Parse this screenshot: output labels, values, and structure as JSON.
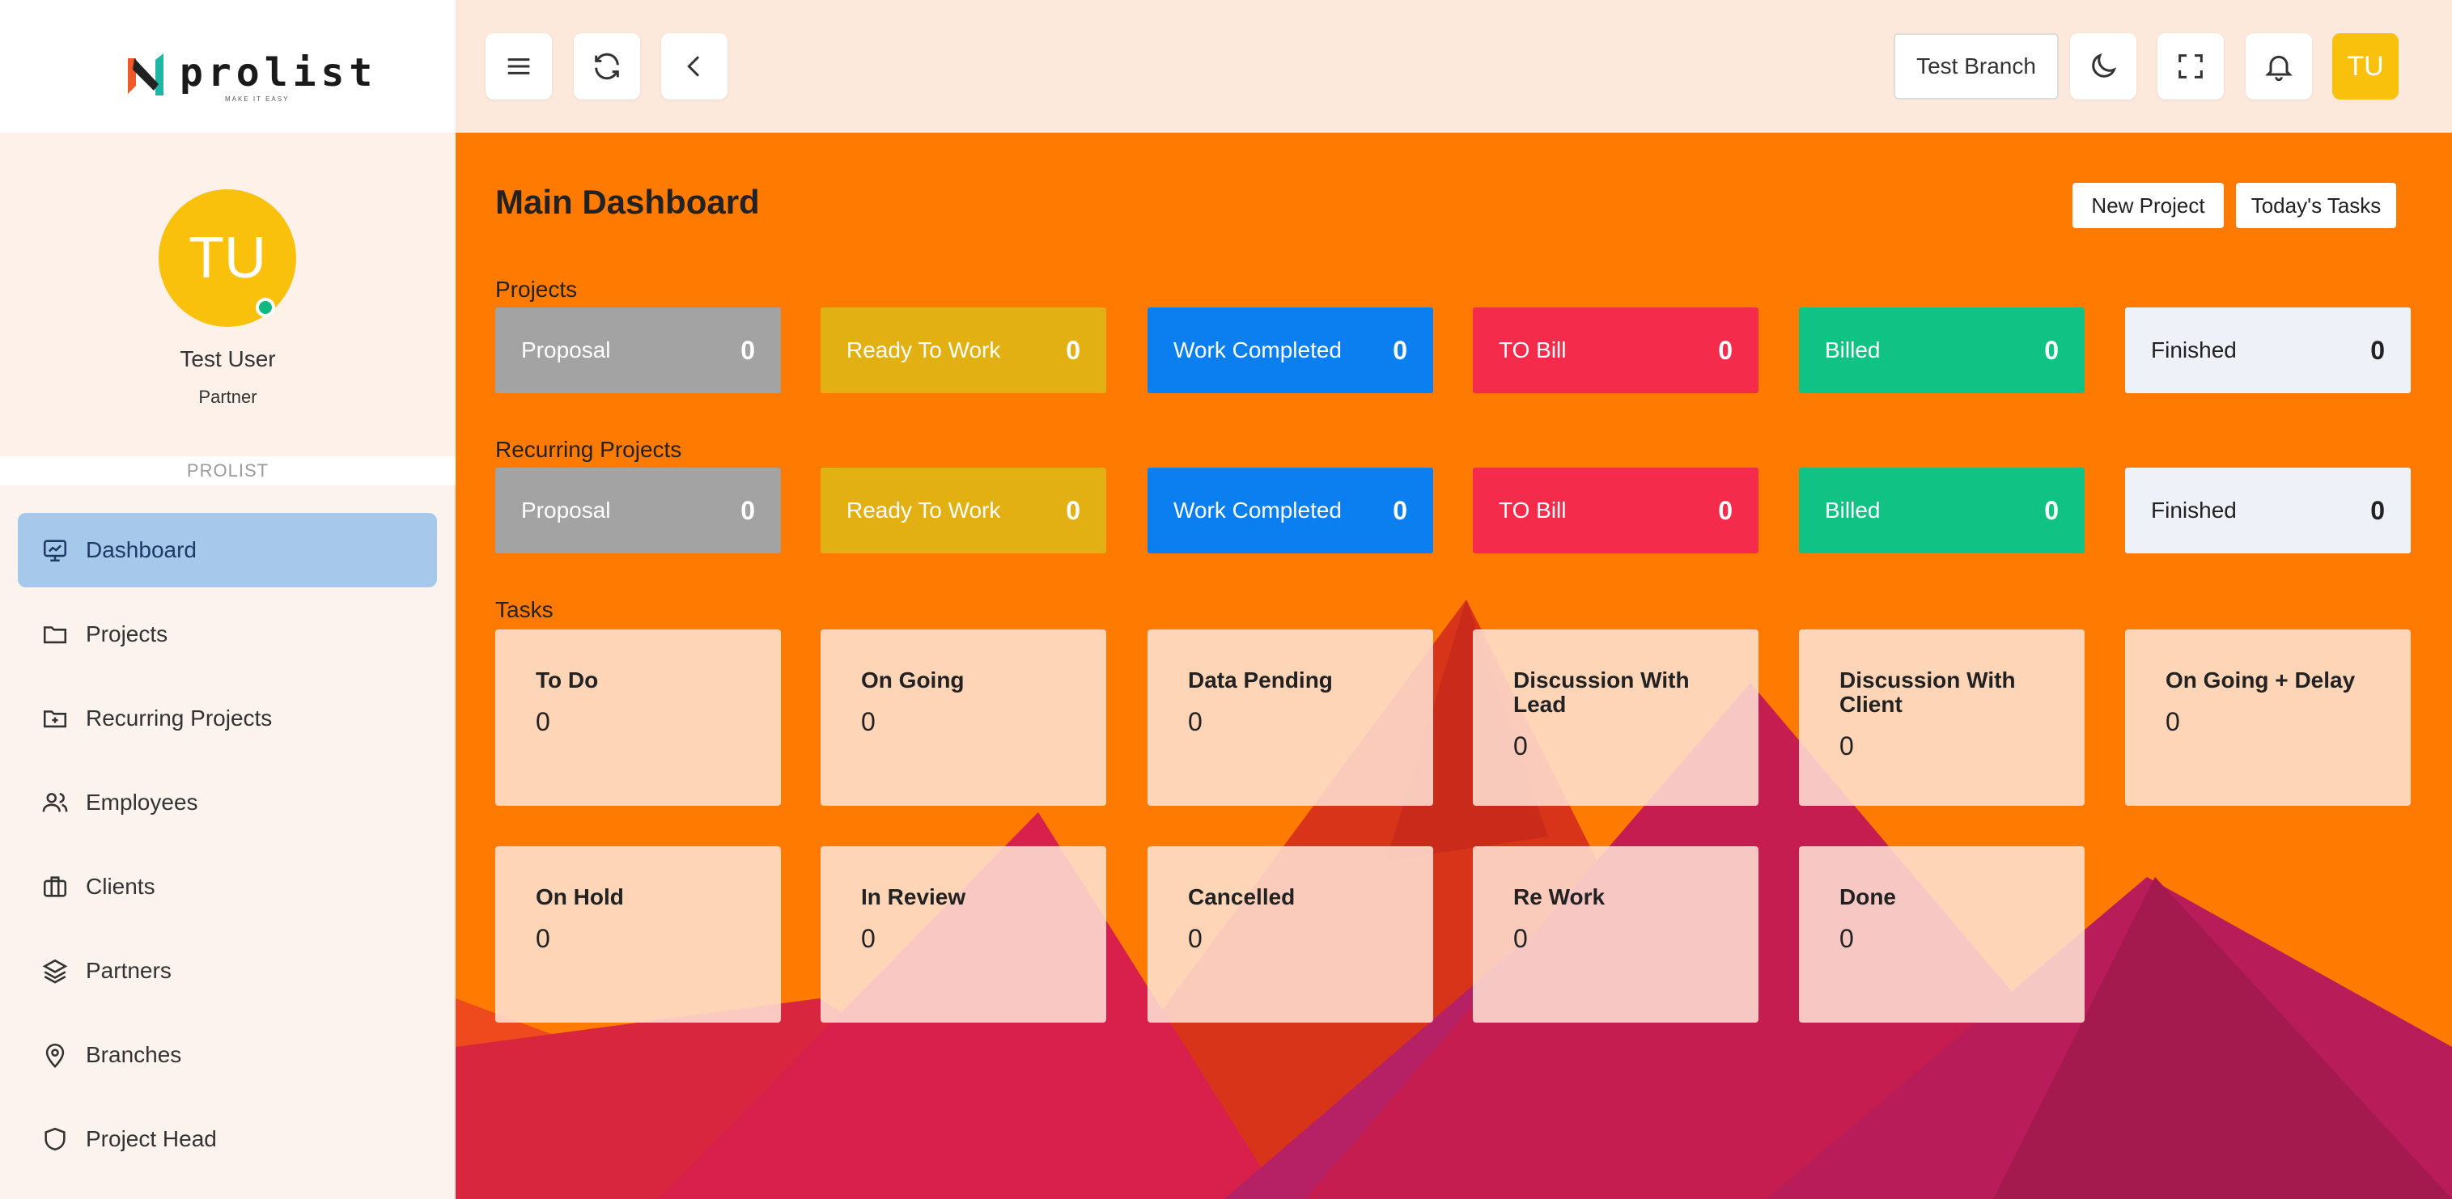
{
  "brand": {
    "name": "prolist",
    "tagline": "MAKE IT EASY"
  },
  "user": {
    "initials": "TU",
    "name": "Test User",
    "role": "Partner"
  },
  "sidebar": {
    "section_label": "PROLIST",
    "items": [
      {
        "label": "Dashboard",
        "icon": "dashboard-icon",
        "active": true
      },
      {
        "label": "Projects",
        "icon": "folder-icon"
      },
      {
        "label": "Recurring Projects",
        "icon": "folder-plus-icon"
      },
      {
        "label": "Employees",
        "icon": "users-icon"
      },
      {
        "label": "Clients",
        "icon": "briefcase-icon"
      },
      {
        "label": "Partners",
        "icon": "layers-icon"
      },
      {
        "label": "Branches",
        "icon": "map-pin-icon"
      },
      {
        "label": "Project Head",
        "icon": "shield-icon"
      }
    ]
  },
  "topbar": {
    "branch": "Test Branch",
    "avatar": "TU"
  },
  "main": {
    "title": "Main Dashboard",
    "new_project": "New Project",
    "todays_tasks": "Today's Tasks",
    "projects_label": "Projects",
    "recurring_label": "Recurring Projects",
    "tasks_label": "Tasks",
    "projects": [
      {
        "label": "Proposal",
        "value": "0",
        "color": "#a3a3a3"
      },
      {
        "label": "Ready To Work",
        "value": "0",
        "color": "#e2b012"
      },
      {
        "label": "Work Completed",
        "value": "0",
        "color": "#0b7ef0"
      },
      {
        "label": "TO Bill",
        "value": "0",
        "color": "#f42b4b"
      },
      {
        "label": "Billed",
        "value": "0",
        "color": "#10c384"
      },
      {
        "label": "Finished",
        "value": "0",
        "color": "#eef1f8"
      }
    ],
    "recurring": [
      {
        "label": "Proposal",
        "value": "0",
        "color": "#a3a3a3"
      },
      {
        "label": "Ready To Work",
        "value": "0",
        "color": "#e2b012"
      },
      {
        "label": "Work Completed",
        "value": "0",
        "color": "#0b7ef0"
      },
      {
        "label": "TO Bill",
        "value": "0",
        "color": "#f42b4b"
      },
      {
        "label": "Billed",
        "value": "0",
        "color": "#10c384"
      },
      {
        "label": "Finished",
        "value": "0",
        "color": "#eef1f8"
      }
    ],
    "tasks": [
      {
        "label": "To Do",
        "value": "0"
      },
      {
        "label": "On Going",
        "value": "0"
      },
      {
        "label": "Data Pending",
        "value": "0"
      },
      {
        "label": "Discussion With Lead",
        "value": "0"
      },
      {
        "label": "Discussion With Client",
        "value": "0"
      },
      {
        "label": "On Going + Delay",
        "value": "0"
      },
      {
        "label": "On Hold",
        "value": "0"
      },
      {
        "label": "In Review",
        "value": "0"
      },
      {
        "label": "Cancelled",
        "value": "0"
      },
      {
        "label": "Re Work",
        "value": "0"
      },
      {
        "label": "Done",
        "value": "0"
      }
    ]
  }
}
